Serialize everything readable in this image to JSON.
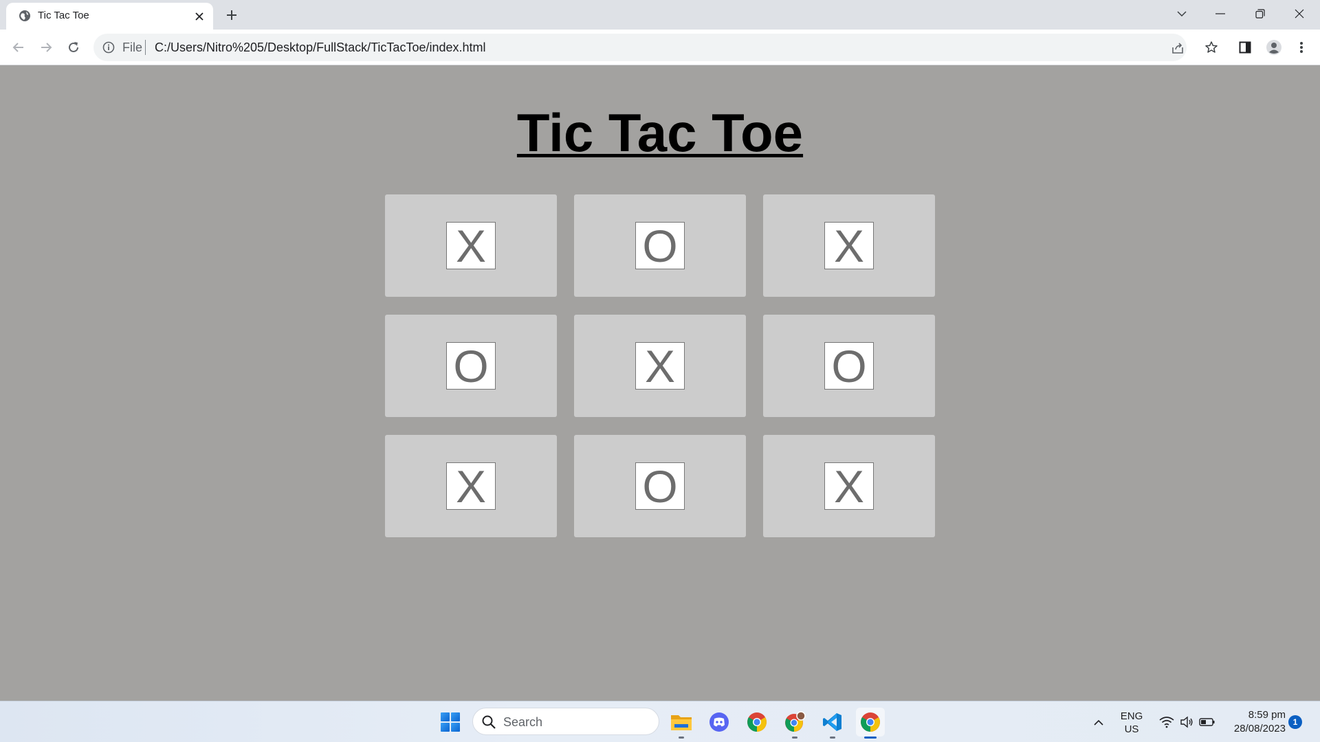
{
  "browser": {
    "tab_title": "Tic Tac Toe",
    "address": {
      "scheme_label": "File",
      "url": "C:/Users/Nitro%205/Desktop/FullStack/TicTacToe/index.html"
    }
  },
  "game": {
    "title": "Tic Tac Toe",
    "board": [
      [
        "X",
        "O",
        "X"
      ],
      [
        "O",
        "X",
        "O"
      ],
      [
        "X",
        "O",
        "X"
      ]
    ]
  },
  "taskbar": {
    "search_placeholder": "Search",
    "language": "ENG",
    "region": "US",
    "time": "8:59 pm",
    "date": "28/08/2023",
    "notification_count": "1"
  },
  "colors": {
    "page_background": "#a3a2a0",
    "cell_background": "#cccccc",
    "mark_color": "#6d6d6d"
  }
}
